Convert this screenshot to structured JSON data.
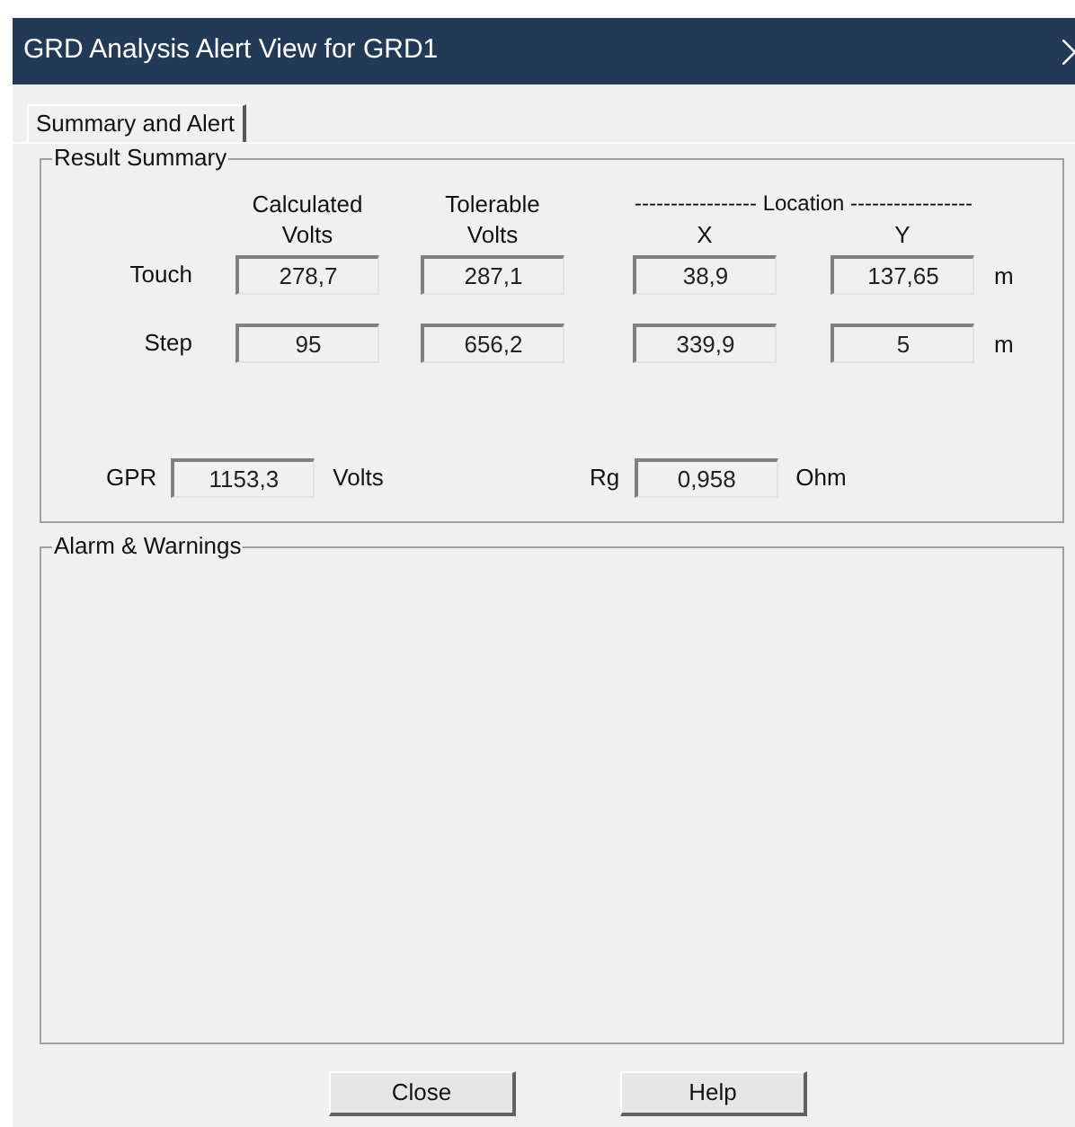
{
  "window": {
    "title": "GRD Analysis Alert View for GRD1"
  },
  "tabs": [
    {
      "label": "Summary and Alert",
      "selected": true
    }
  ],
  "result_summary": {
    "title": "Result Summary",
    "column_headers": [
      [
        "Calculated",
        "Volts"
      ],
      [
        "Tolerable",
        "Volts"
      ],
      [
        "X"
      ],
      [
        "Y"
      ]
    ],
    "location_header": "----------------- Location -----------------",
    "rows": [
      {
        "label": "Touch",
        "values": [
          "278,7",
          "287,1",
          "38,9",
          "137,65"
        ],
        "unit": "m"
      },
      {
        "label": "Step",
        "values": [
          "95",
          "656,2",
          "339,9",
          "5"
        ],
        "unit": "m"
      }
    ],
    "gpr": {
      "label": "GPR",
      "value": "1153,3",
      "unit": "Volts"
    },
    "rg": {
      "label": "Rg",
      "value": "0,958",
      "unit": "Ohm"
    }
  },
  "alarm_warnings": {
    "title": "Alarm & Warnings"
  },
  "buttons": [
    "Close",
    "Help"
  ]
}
